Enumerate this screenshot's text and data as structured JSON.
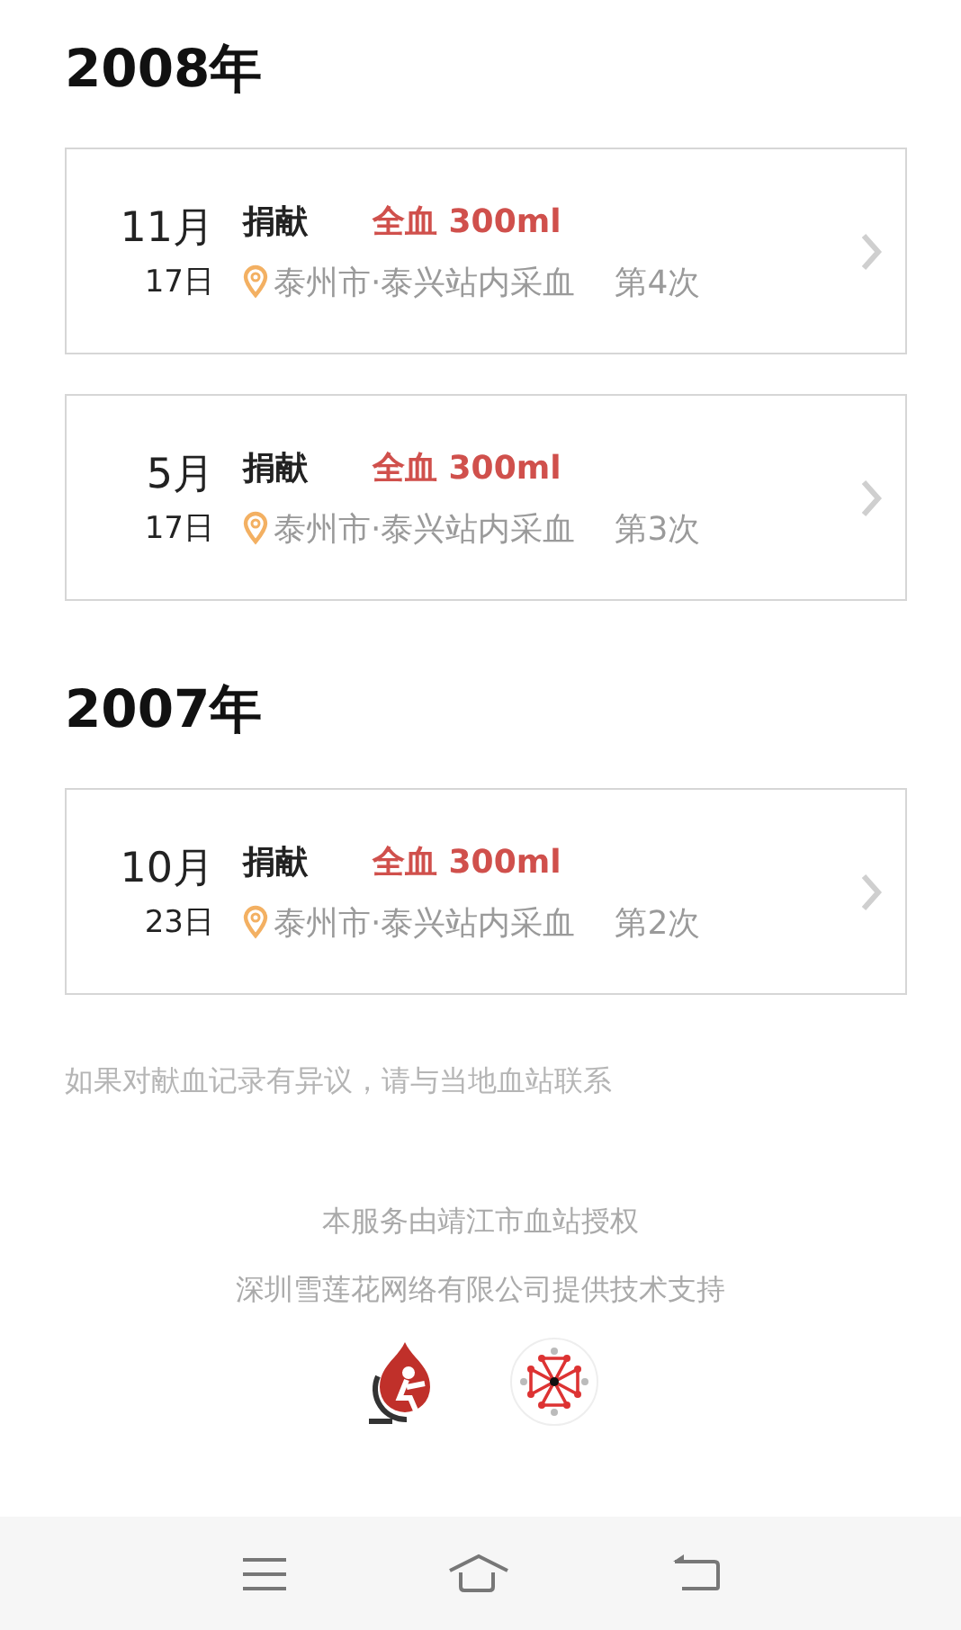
{
  "years": [
    {
      "year": "2008年",
      "records": [
        {
          "month": "11月",
          "day": "17日",
          "type": "捐献",
          "product": "全血 300ml",
          "location": "泰州市·泰兴站内采血",
          "count": "第4次"
        },
        {
          "month": "5月",
          "day": "17日",
          "type": "捐献",
          "product": "全血 300ml",
          "location": "泰州市·泰兴站内采血",
          "count": "第3次"
        }
      ]
    },
    {
      "year": "2007年",
      "records": [
        {
          "month": "10月",
          "day": "23日",
          "type": "捐献",
          "product": "全血 300ml",
          "location": "泰州市·泰兴站内采血",
          "count": "第2次"
        }
      ]
    }
  ],
  "notice": "如果对献血记录有异议，请与当地血站联系",
  "footer": {
    "lines": [
      "本服务由靖江市血站授权",
      "深圳雪莲花网络有限公司提供技术支持"
    ]
  }
}
